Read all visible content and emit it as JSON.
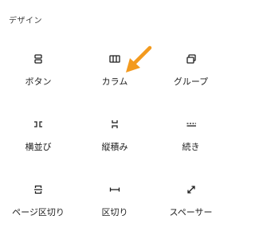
{
  "category": {
    "title": "デザイン"
  },
  "blocks": [
    {
      "label": "ボタン",
      "icon": "buttons-icon"
    },
    {
      "label": "カラム",
      "icon": "columns-icon"
    },
    {
      "label": "グループ",
      "icon": "group-icon"
    },
    {
      "label": "横並び",
      "icon": "row-icon"
    },
    {
      "label": "縦積み",
      "icon": "stack-icon"
    },
    {
      "label": "続き",
      "icon": "more-icon"
    },
    {
      "label": "ページ区切り",
      "icon": "page-break-icon"
    },
    {
      "label": "区切り",
      "icon": "separator-icon"
    },
    {
      "label": "スペーサー",
      "icon": "spacer-icon"
    }
  ],
  "colors": {
    "icon": "#1e1e1e",
    "annotation_arrow": "#f39a1e"
  }
}
